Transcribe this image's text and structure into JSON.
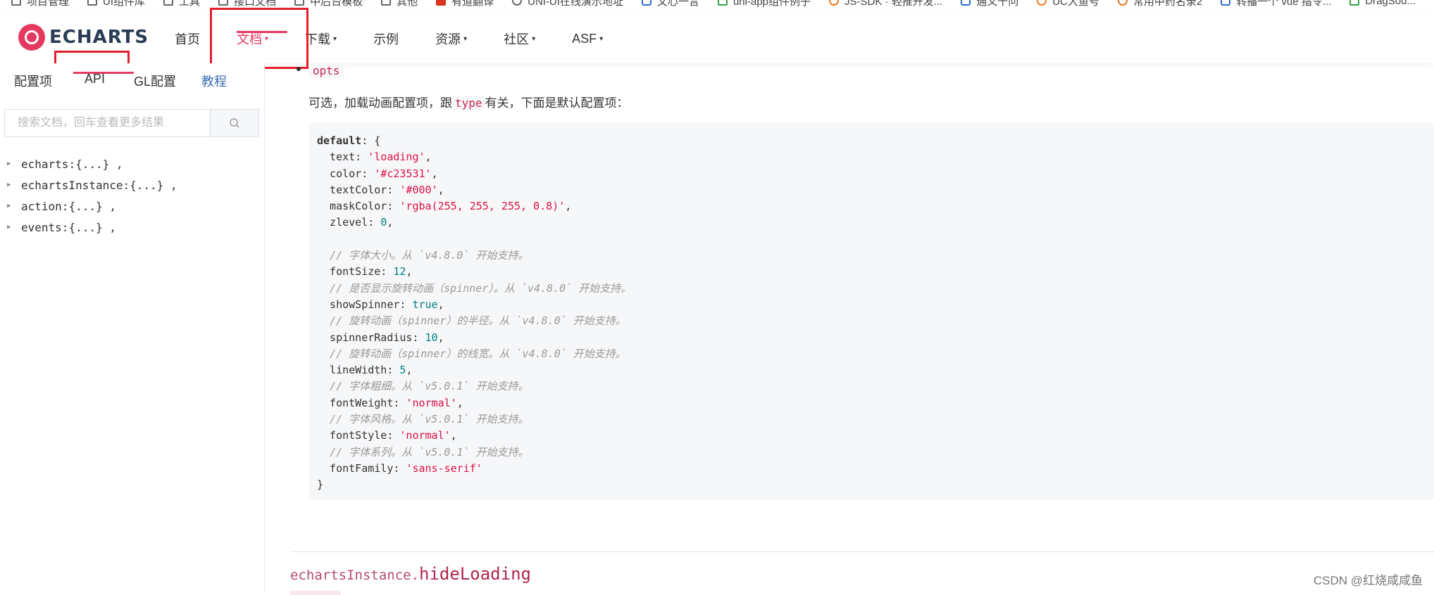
{
  "bookmarks": [
    {
      "label": "项目管理",
      "icon": "folder-icon"
    },
    {
      "label": "UI组件库",
      "icon": "folder-icon"
    },
    {
      "label": "工具",
      "icon": "folder-icon"
    },
    {
      "label": "接口文档",
      "icon": "folder-icon"
    },
    {
      "label": "中后台模板",
      "icon": "folder-icon"
    },
    {
      "label": "其他",
      "icon": "folder-icon"
    },
    {
      "label": "有道翻译",
      "icon": "youdao-icon"
    },
    {
      "label": "UNI-UI在线演示地址",
      "icon": "globe-icon"
    },
    {
      "label": "文心一言",
      "icon": "wenxin-icon"
    },
    {
      "label": "uni-app组件例子",
      "icon": "uniapp-icon"
    },
    {
      "label": "JS-SDK · 轻推开发...",
      "icon": "jssdk-icon"
    },
    {
      "label": "通义千问",
      "icon": "tongyi-icon"
    },
    {
      "label": "UC大鱼号",
      "icon": "uc-icon"
    },
    {
      "label": "常用中药名录2",
      "icon": "herb-icon"
    },
    {
      "label": "转播一个 vue 指令...",
      "icon": "vue-icon"
    },
    {
      "label": "DragSou...",
      "icon": "doc-icon"
    }
  ],
  "header": {
    "logo_text": "ECHARTS",
    "nav": [
      {
        "label": "首页",
        "has_caret": false,
        "active": false
      },
      {
        "label": "文档",
        "has_caret": true,
        "active": true
      },
      {
        "label": "下载",
        "has_caret": true,
        "active": false
      },
      {
        "label": "示例",
        "has_caret": false,
        "active": false
      },
      {
        "label": "资源",
        "has_caret": true,
        "active": false
      },
      {
        "label": "社区",
        "has_caret": true,
        "active": false
      },
      {
        "label": "ASF",
        "has_caret": true,
        "active": false
      }
    ],
    "caret_glyph": "▾",
    "accent_color": "#e43961"
  },
  "sidebar": {
    "tabs": {
      "config": "配置项",
      "api": "API",
      "gl": "GL配置",
      "tutorial": "教程"
    },
    "search_placeholder": "搜索文档，回车查看更多结果",
    "tree": [
      {
        "key": "echarts",
        "value": "{...} ,"
      },
      {
        "key": "echartsInstance",
        "value": "{...} ,"
      },
      {
        "key": "action",
        "value": "{...} ,"
      },
      {
        "key": "events",
        "value": "{...} ,"
      }
    ]
  },
  "content": {
    "param_name": "opts",
    "desc_before": "可选，加载动画配置项，跟",
    "desc_code": "type",
    "desc_after": "有关，下面是默认配置项：",
    "code_lines": [
      [
        {
          "t": "k",
          "v": "default"
        },
        {
          "t": "p",
          "v": ": {"
        }
      ],
      [
        {
          "t": "p",
          "v": "  text: "
        },
        {
          "t": "s",
          "v": "'loading'"
        },
        {
          "t": "p",
          "v": ","
        }
      ],
      [
        {
          "t": "p",
          "v": "  color: "
        },
        {
          "t": "s",
          "v": "'#c23531'"
        },
        {
          "t": "p",
          "v": ","
        }
      ],
      [
        {
          "t": "p",
          "v": "  textColor: "
        },
        {
          "t": "s",
          "v": "'#000'"
        },
        {
          "t": "p",
          "v": ","
        }
      ],
      [
        {
          "t": "p",
          "v": "  maskColor: "
        },
        {
          "t": "s",
          "v": "'rgba(255, 255, 255, 0.8)'"
        },
        {
          "t": "p",
          "v": ","
        }
      ],
      [
        {
          "t": "p",
          "v": "  zlevel: "
        },
        {
          "t": "n",
          "v": "0"
        },
        {
          "t": "p",
          "v": ","
        }
      ],
      [
        {
          "t": "p",
          "v": ""
        }
      ],
      [
        {
          "t": "c",
          "v": "  // 字体大小。从 `v4.8.0` 开始支持。"
        }
      ],
      [
        {
          "t": "p",
          "v": "  fontSize: "
        },
        {
          "t": "n",
          "v": "12"
        },
        {
          "t": "p",
          "v": ","
        }
      ],
      [
        {
          "t": "c",
          "v": "  // 是否显示旋转动画（spinner）。从 `v4.8.0` 开始支持。"
        }
      ],
      [
        {
          "t": "p",
          "v": "  showSpinner: "
        },
        {
          "t": "n",
          "v": "true"
        },
        {
          "t": "p",
          "v": ","
        }
      ],
      [
        {
          "t": "c",
          "v": "  // 旋转动画（spinner）的半径。从 `v4.8.0` 开始支持。"
        }
      ],
      [
        {
          "t": "p",
          "v": "  spinnerRadius: "
        },
        {
          "t": "n",
          "v": "10"
        },
        {
          "t": "p",
          "v": ","
        }
      ],
      [
        {
          "t": "c",
          "v": "  // 旋转动画（spinner）的线宽。从 `v4.8.0` 开始支持。"
        }
      ],
      [
        {
          "t": "p",
          "v": "  lineWidth: "
        },
        {
          "t": "n",
          "v": "5"
        },
        {
          "t": "p",
          "v": ","
        }
      ],
      [
        {
          "t": "c",
          "v": "  // 字体粗细。从 `v5.0.1` 开始支持。"
        }
      ],
      [
        {
          "t": "p",
          "v": "  fontWeight: "
        },
        {
          "t": "s",
          "v": "'normal'"
        },
        {
          "t": "p",
          "v": ","
        }
      ],
      [
        {
          "t": "c",
          "v": "  // 字体风格。从 `v5.0.1` 开始支持。"
        }
      ],
      [
        {
          "t": "p",
          "v": "  fontStyle: "
        },
        {
          "t": "s",
          "v": "'normal'"
        },
        {
          "t": "p",
          "v": ","
        }
      ],
      [
        {
          "t": "c",
          "v": "  // 字体系列。从 `v5.0.1` 开始支持。"
        }
      ],
      [
        {
          "t": "p",
          "v": "  fontFamily: "
        },
        {
          "t": "s",
          "v": "'sans-serif'"
        }
      ],
      [
        {
          "t": "p",
          "v": "}"
        }
      ]
    ],
    "next_section_prefix": "echartsInstance.",
    "next_section_name": "hideLoading"
  },
  "watermark": "CSDN @红烧咸咸鱼",
  "annotation_color": "#e41e2b"
}
